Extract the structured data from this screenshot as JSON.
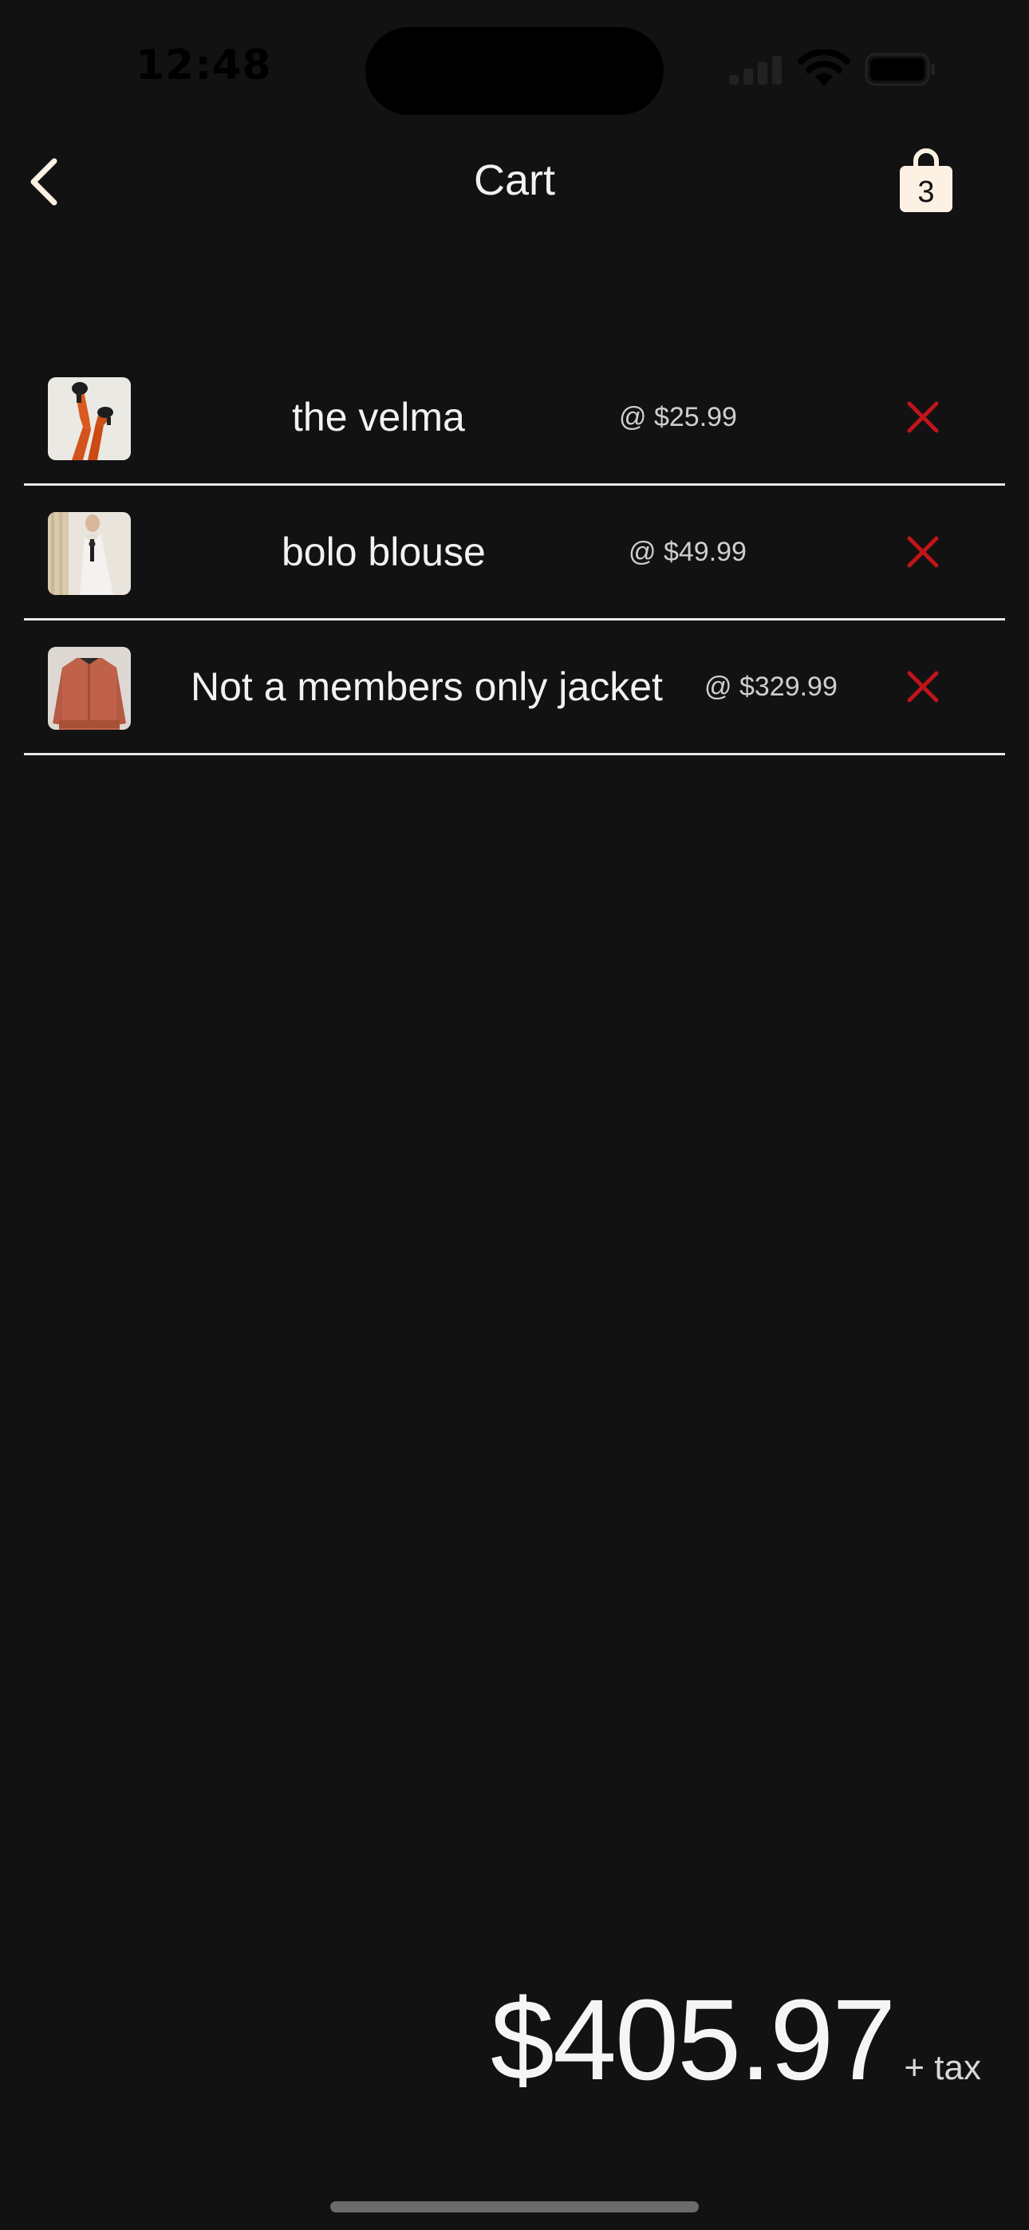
{
  "status_bar": {
    "time": "12:48"
  },
  "nav": {
    "title": "Cart",
    "bag_count": "3"
  },
  "cart": {
    "items": [
      {
        "name": "the velma",
        "price": "@ $25.99"
      },
      {
        "name": "bolo blouse",
        "price": "@ $49.99"
      },
      {
        "name": "Not a members only jacket",
        "price": "@ $329.99"
      }
    ]
  },
  "total": {
    "amount": "$405.97",
    "suffix": "+ tax"
  },
  "colors": {
    "background": "#121212",
    "accent": "#fdf1e4",
    "remove": "#c0141a",
    "text": "#f2f2f2"
  },
  "icons": [
    "chevron-left-icon",
    "shopping-bag-icon",
    "close-icon",
    "signal-icon",
    "wifi-icon",
    "battery-icon"
  ]
}
